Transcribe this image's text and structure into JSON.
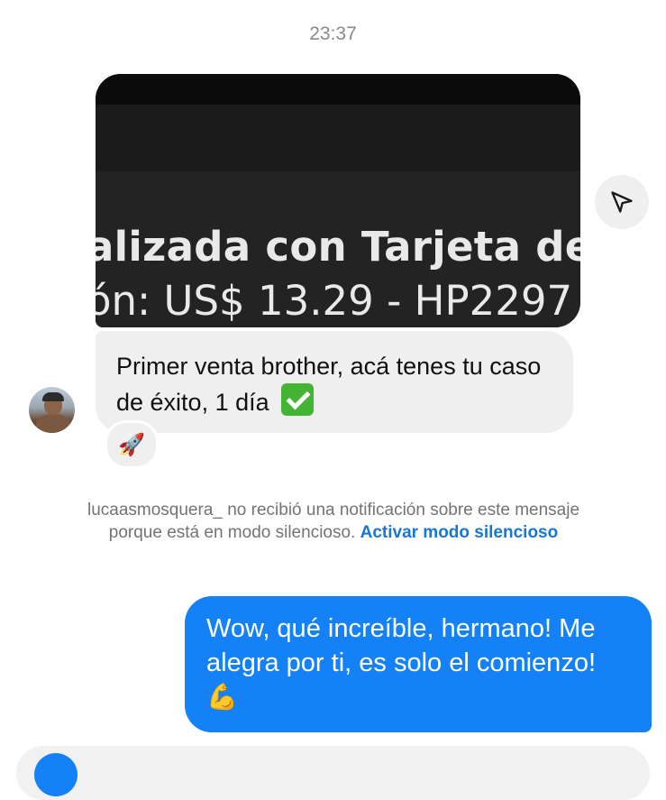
{
  "timestamp": "23:37",
  "image_message": {
    "line1": "alizada con Tarjeta de C",
    "line2": "ón: US$ 13.29 - HP2297"
  },
  "share_icon": "paper-plane-icon",
  "incoming_message": {
    "text": "Primer venta brother, acá tenes tu caso de éxito, 1 día",
    "emoji": "check-mark-button-icon"
  },
  "reaction": {
    "emoji": "🚀",
    "icon": "rocket-icon"
  },
  "notice": {
    "text": "lucaasmosquera_ no recibió una notificación sobre este mensaje porque está en modo silencioso.",
    "link": "Activar modo silencioso"
  },
  "outgoing_message": {
    "text": "Wow, qué increíble, hermano! Me alegra por ti, es solo el comienzo!",
    "emoji": "💪"
  },
  "colors": {
    "outgoing_bubble": "#1481f6",
    "incoming_bubble": "#efefef",
    "link": "#1877d2",
    "muted_text": "#737373"
  }
}
